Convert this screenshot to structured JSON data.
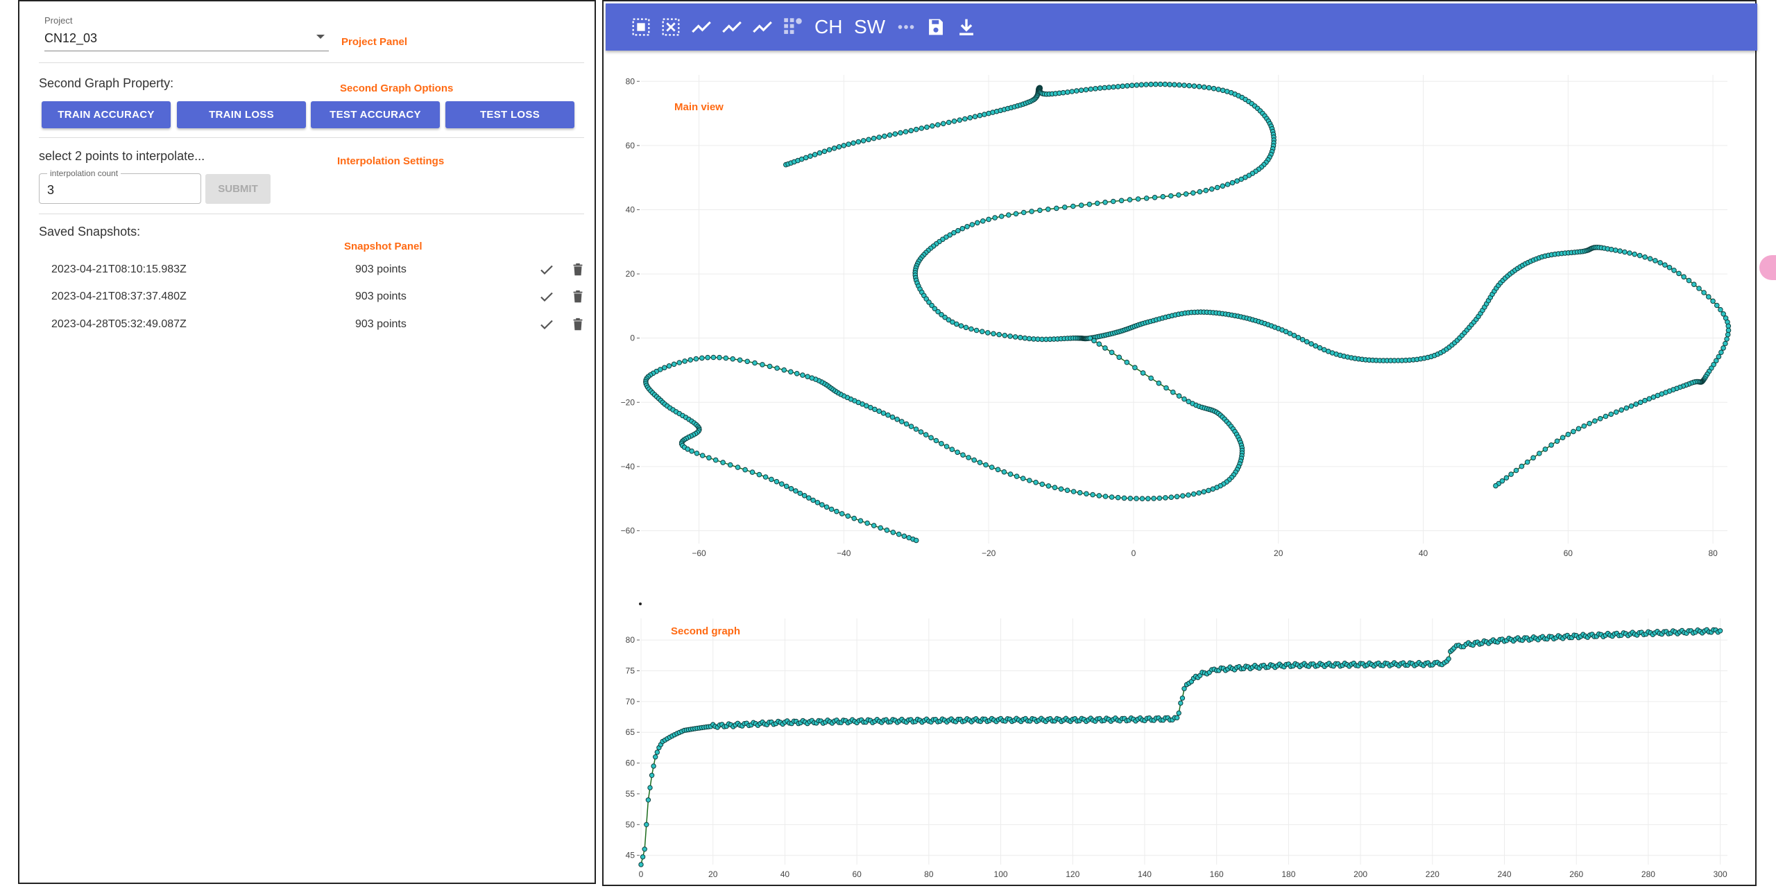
{
  "project_panel": {
    "field_label": "Project",
    "selected_project": "CN12_03",
    "annotation": "Project Panel"
  },
  "second_graph_options": {
    "title": "Second Graph Property:",
    "annotation": "Second Graph Options",
    "buttons": [
      "TRAIN ACCURACY",
      "TRAIN LOSS",
      "TEST ACCURACY",
      "TEST LOSS"
    ]
  },
  "interpolation": {
    "title": "select 2 points to interpolate...",
    "annotation": "Interpolation Settings",
    "input_label": "interpolation count",
    "input_value": "3",
    "submit_label": "SUBMIT"
  },
  "snapshots": {
    "title": "Saved Snapshots:",
    "annotation": "Snapshot Panel",
    "items": [
      {
        "timestamp": "2023-04-21T08:10:15.983Z",
        "points": "903 points"
      },
      {
        "timestamp": "2023-04-21T08:37:37.480Z",
        "points": "903 points"
      },
      {
        "timestamp": "2023-04-28T05:32:49.087Z",
        "points": "903 points"
      }
    ]
  },
  "toolbar": {
    "items": [
      {
        "name": "select-all-icon"
      },
      {
        "name": "deselect-icon"
      },
      {
        "name": "line-chart-icon"
      },
      {
        "name": "line-chart-icon"
      },
      {
        "name": "line-chart-icon"
      },
      {
        "name": "grid-settings-icon"
      },
      {
        "name": "ch-text",
        "label": "CH"
      },
      {
        "name": "sw-text",
        "label": "SW"
      },
      {
        "name": "more-horizontal-icon"
      },
      {
        "name": "save-icon"
      },
      {
        "name": "download-icon"
      }
    ]
  },
  "colors": {
    "accent": "#5468d4",
    "annotation": "#ff6a13",
    "point_fill": "#2ec4c4",
    "line": "#1b6b1b"
  },
  "chart_data": [
    {
      "type": "scatter",
      "title": "",
      "annotation": "Main view",
      "xlim": [
        -68,
        82
      ],
      "ylim": [
        -64,
        82
      ],
      "x_ticks": [
        -60,
        -40,
        -20,
        0,
        20,
        40,
        60,
        80
      ],
      "y_ticks": [
        -60,
        -40,
        -20,
        0,
        20,
        40,
        60,
        80
      ],
      "grid": true,
      "series": [
        {
          "points": [
            [
              -48,
              54
            ],
            [
              -40,
              60
            ],
            [
              -30,
              65
            ],
            [
              -20,
              70
            ],
            [
              -14,
              74
            ],
            [
              -13,
              78
            ],
            [
              -12,
              76
            ],
            [
              -4,
              78
            ],
            [
              5,
              79
            ],
            [
              14,
              76
            ],
            [
              19,
              66
            ],
            [
              18,
              54
            ],
            [
              10,
              46
            ],
            [
              -5,
              42
            ],
            [
              -20,
              37
            ],
            [
              -28,
              28
            ],
            [
              -30,
              18
            ],
            [
              -25,
              5
            ],
            [
              -15,
              0
            ],
            [
              -8,
              0
            ],
            [
              -6,
              0
            ],
            [
              -2,
              2
            ],
            [
              2,
              5
            ],
            [
              8,
              8
            ],
            [
              14,
              7
            ],
            [
              20,
              3
            ],
            [
              28,
              -5
            ],
            [
              35,
              -7
            ],
            [
              42,
              -5
            ],
            [
              47,
              5
            ],
            [
              51,
              18
            ],
            [
              56,
              25
            ],
            [
              62,
              27
            ],
            [
              65,
              28
            ],
            [
              74,
              22
            ],
            [
              82,
              5
            ],
            [
              79,
              -12
            ],
            [
              77,
              -14
            ],
            [
              70,
              -20
            ],
            [
              60,
              -30
            ],
            [
              50,
              -46
            ]
          ]
        },
        {
          "points": [
            [
              -6,
              0
            ],
            [
              7,
              -19
            ],
            [
              12,
              -24
            ],
            [
              15,
              -35
            ],
            [
              12,
              -46
            ],
            [
              2,
              -50
            ],
            [
              -10,
              -47
            ],
            [
              -22,
              -38
            ],
            [
              -32,
              -26
            ],
            [
              -40,
              -18
            ],
            [
              -45,
              -12
            ],
            [
              -58,
              -6
            ],
            [
              -67,
              -12
            ],
            [
              -65,
              -20
            ],
            [
              -60,
              -28
            ],
            [
              -62,
              -34
            ],
            [
              -50,
              -44
            ],
            [
              -41,
              -54
            ],
            [
              -30,
              -63
            ]
          ]
        }
      ]
    },
    {
      "type": "line",
      "title": "",
      "annotation": "Second graph",
      "xlim": [
        0,
        302
      ],
      "ylim": [
        43.5,
        83.5
      ],
      "x_ticks": [
        0,
        20,
        40,
        60,
        80,
        100,
        120,
        140,
        160,
        180,
        200,
        220,
        240,
        260,
        280,
        300
      ],
      "y_ticks": [
        45,
        50,
        55,
        60,
        65,
        70,
        75,
        80
      ],
      "grid": true,
      "x": [
        0,
        1,
        2,
        3,
        4,
        5,
        6,
        8,
        10,
        12,
        15,
        20,
        30,
        40,
        60,
        80,
        100,
        120,
        140,
        149,
        150,
        151,
        153,
        156,
        160,
        170,
        180,
        200,
        220,
        224,
        225,
        226,
        230,
        240,
        260,
        280,
        300
      ],
      "values": [
        43.5,
        46,
        54,
        58,
        61,
        62.5,
        63.5,
        64.2,
        64.8,
        65.3,
        65.6,
        66,
        66.3,
        66.6,
        66.8,
        66.9,
        67,
        67,
        67.1,
        67.2,
        69.5,
        72,
        73.5,
        74.5,
        75.2,
        75.6,
        75.9,
        76,
        76.1,
        76.3,
        78,
        78.8,
        79.3,
        80,
        80.6,
        81.1,
        81.5
      ]
    }
  ]
}
